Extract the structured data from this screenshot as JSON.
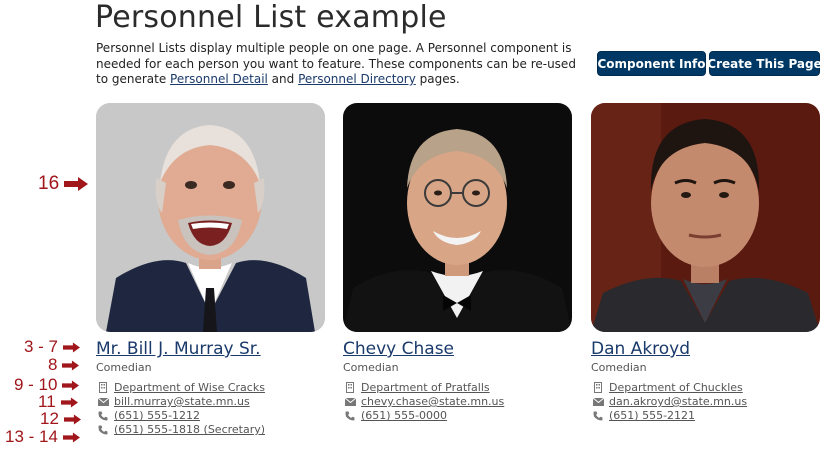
{
  "page": {
    "title": "Personnel List example",
    "intro": {
      "text_before": "Personnel Lists display multiple people on one page. A Personnel component is needed for each person you want to feature. These components can be re-used to generate ",
      "link1": "Personnel Detail",
      "text_middle": " and ",
      "link2": "Personnel Directory",
      "text_after": " pages."
    }
  },
  "buttons": {
    "info": "Component Info",
    "create": "Create This Page"
  },
  "people": [
    {
      "name": "Mr. Bill J. Murray Sr.",
      "role": "Comedian",
      "department": "Department of Wise Cracks",
      "email": "bill.murray@state.mn.us",
      "phone": " (651) 555-1212",
      "phone2": " (651) 555-1818 (Secretary)"
    },
    {
      "name": "Chevy Chase",
      "role": "Comedian",
      "department": "Department of Pratfalls",
      "email": "chevy.chase@state.mn.us",
      "phone": " (651) 555-0000"
    },
    {
      "name": "Dan Akroyd",
      "role": "Comedian",
      "department": "Department of Chuckles",
      "email": "dan.akroyd@state.mn.us",
      "phone": " (651) 555-2121"
    }
  ],
  "annotations": {
    "photo": "16",
    "name": "3 - 7",
    "role": "8",
    "department": "9 - 10",
    "email": "11",
    "phone": "12",
    "phone2": "13 - 14"
  },
  "icons": {
    "department": "building-icon",
    "email": "envelope-icon",
    "phone": "phone-icon",
    "annotation_arrow": "arrow-right-icon"
  },
  "colors": {
    "button": "#003865",
    "link": "#1a3a6b",
    "annotation": "#a0161b"
  }
}
